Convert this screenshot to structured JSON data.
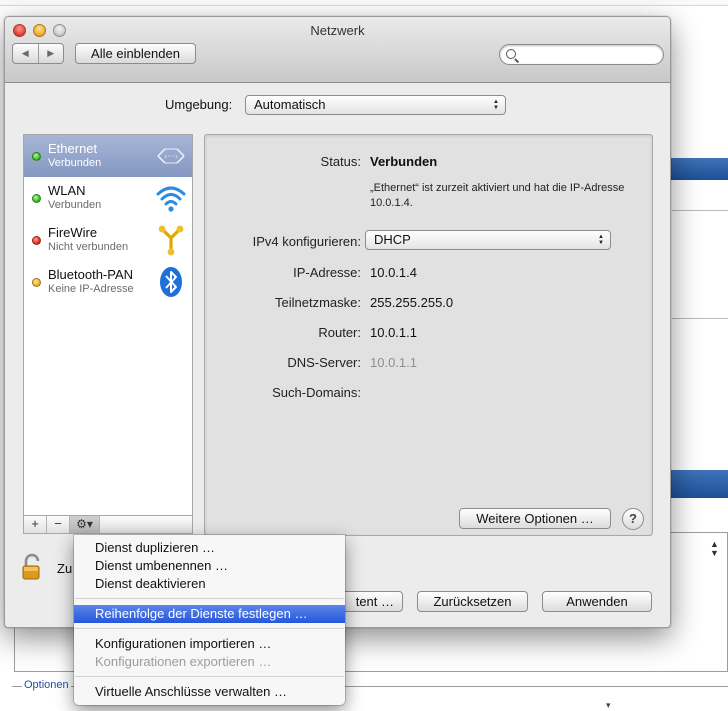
{
  "window": {
    "title": "Netzwerk",
    "show_all_label": "Alle einblenden",
    "search_placeholder": ""
  },
  "location": {
    "label": "Umgebung:",
    "value": "Automatisch"
  },
  "services": [
    {
      "name": "Ethernet",
      "status": "Verbunden",
      "dot": "green",
      "icon": "ethernet-icon",
      "selected": true
    },
    {
      "name": "WLAN",
      "status": "Verbunden",
      "dot": "green",
      "icon": "wifi-icon",
      "selected": false
    },
    {
      "name": "FireWire",
      "status": "Nicht verbunden",
      "dot": "red",
      "icon": "firewire-icon",
      "selected": false
    },
    {
      "name": "Bluetooth-PAN",
      "status": "Keine IP-Adresse",
      "dot": "yellow",
      "icon": "bluetooth-icon",
      "selected": false
    }
  ],
  "toolbar": {
    "add": "+",
    "remove": "−",
    "gear": "⚙▾"
  },
  "detail": {
    "status_label": "Status:",
    "status_value": "Verbunden",
    "status_note": "„Ethernet“ ist zurzeit aktiviert und hat die IP-Adresse 10.0.1.4.",
    "ipv4_label": "IPv4 konfigurieren:",
    "ipv4_value": "DHCP",
    "ip_label": "IP-Adresse:",
    "ip_value": "10.0.1.4",
    "subnet_label": "Teilnetzmaske:",
    "subnet_value": "255.255.255.0",
    "router_label": "Router:",
    "router_value": "10.0.1.1",
    "dns_label": "DNS-Server:",
    "dns_value": "10.0.1.1",
    "domains_label": "Such-Domains:",
    "more_options": "Weitere Optionen …",
    "help": "?"
  },
  "footer": {
    "lock_text": "Zu",
    "assist_label": "tent …",
    "reset_label": "Zurücksetzen",
    "apply_label": "Anwenden"
  },
  "menu": {
    "items": [
      {
        "label": "Dienst duplizieren …",
        "enabled": true
      },
      {
        "label": "Dienst umbenennen …",
        "enabled": true
      },
      {
        "label": "Dienst deaktivieren",
        "enabled": true
      },
      {
        "label": "Reihenfolge der Dienste festlegen …",
        "enabled": true,
        "highlighted": true
      },
      {
        "label": "Konfigurationen importieren …",
        "enabled": true
      },
      {
        "label": "Konfigurationen exportieren …",
        "enabled": false
      },
      {
        "label": "Virtuelle Anschlüsse verwalten …",
        "enabled": true
      }
    ]
  },
  "background": {
    "optionen_label": "Optionen"
  },
  "colors": {
    "selection": "#8497c1",
    "menu_highlight": "#2457dc",
    "status_green": "#2bb515",
    "status_red": "#dd2413",
    "status_yellow": "#ecab12"
  }
}
